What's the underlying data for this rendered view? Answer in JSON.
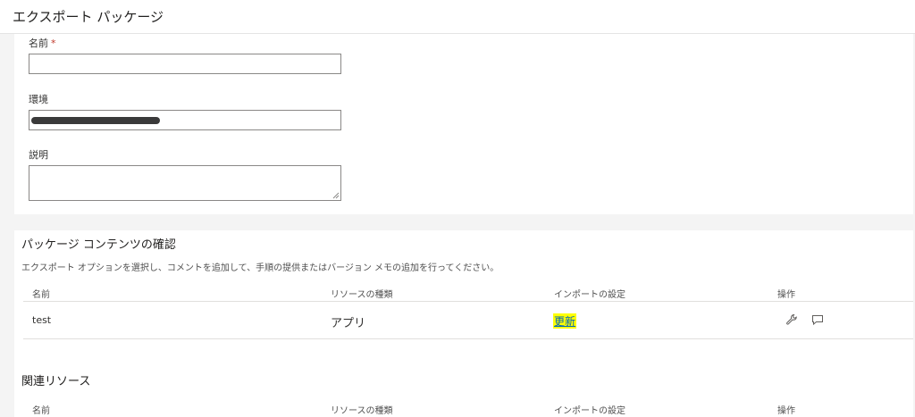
{
  "header": {
    "title": "エクスポート パッケージ"
  },
  "form": {
    "name": {
      "label": "名前",
      "required_mark": "*",
      "value": ""
    },
    "environment": {
      "label": "環境"
    },
    "description": {
      "label": "説明",
      "value": ""
    }
  },
  "package_contents": {
    "title": "パッケージ コンテンツの確認",
    "subtitle": "エクスポート オプションを選択し、コメントを追加して、手順の提供またはバージョン メモの追加を行ってください。",
    "columns": [
      "名前",
      "リソースの種類",
      "インポートの設定",
      "操作"
    ],
    "rows": [
      {
        "name": "test",
        "type": "アプリ",
        "import_setting": "更新",
        "actions": [
          "wrench-icon",
          "comment-icon"
        ]
      }
    ]
  },
  "related_resources": {
    "title": "関連リソース",
    "columns": [
      "名前",
      "リソースの種類",
      "インポートの設定",
      "操作"
    ]
  },
  "colors": {
    "link": "#0066b8",
    "highlight": "#ffff00",
    "required": "#c0392b"
  }
}
